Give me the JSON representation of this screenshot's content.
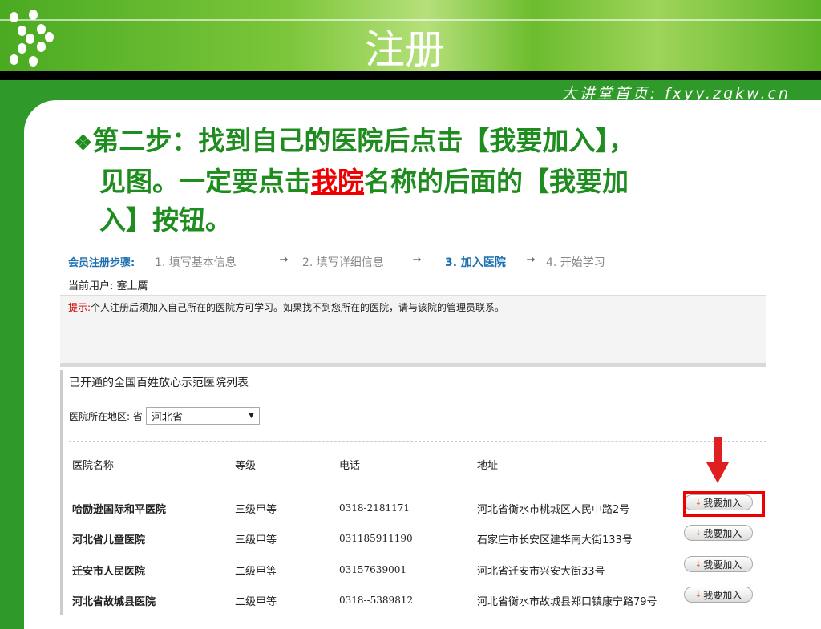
{
  "slide": {
    "title": "注册",
    "site": "大讲堂首页: fxyy.zgkw.cn",
    "instruction": {
      "part1": "第二步：找到自己的医院后点击【我要加入】，",
      "part2": "见图。一定要点击",
      "highlight": "我院",
      "part3": "名称的后面的【我要加",
      "part4": "入】按钮。"
    }
  },
  "screenshot": {
    "steps_label": "会员注册步骤:",
    "steps": [
      "1. 填写基本信息",
      "2. 填写详细信息",
      "3. 加入医院",
      "4. 开始学习"
    ],
    "arrow": "→",
    "current_user": "当前用户: 塞上厲",
    "tip_label": "提示:",
    "tip_text": "个人注册后须加入自己所在的医院方可学习。如果找不到您所在的医院，请与该院的管理员联系。",
    "list_title": "已开通的全国百姓放心示范医院列表",
    "region_label": "医院所在地区: 省",
    "region_value": "河北省",
    "columns": [
      "医院名称",
      "等级",
      "电话",
      "地址"
    ],
    "join_label": "我要加入",
    "rows": [
      {
        "name": "哈励逊国际和平医院",
        "level": "三级甲等",
        "phone": "0318-2181171",
        "address": "河北省衡水市桃城区人民中路2号"
      },
      {
        "name": "河北省儿童医院",
        "level": "三级甲等",
        "phone": "031185911190",
        "address": "石家庄市长安区建华南大街133号"
      },
      {
        "name": "迁安市人民医院",
        "level": "二级甲等",
        "phone": "03157639001",
        "address": "河北省迁安市兴安大街33号"
      },
      {
        "name": "河北省故城县医院",
        "level": "二级甲等",
        "phone": "0318--5389812",
        "address": "河北省衡水市故城县郑口镇康宁路79号"
      }
    ]
  }
}
